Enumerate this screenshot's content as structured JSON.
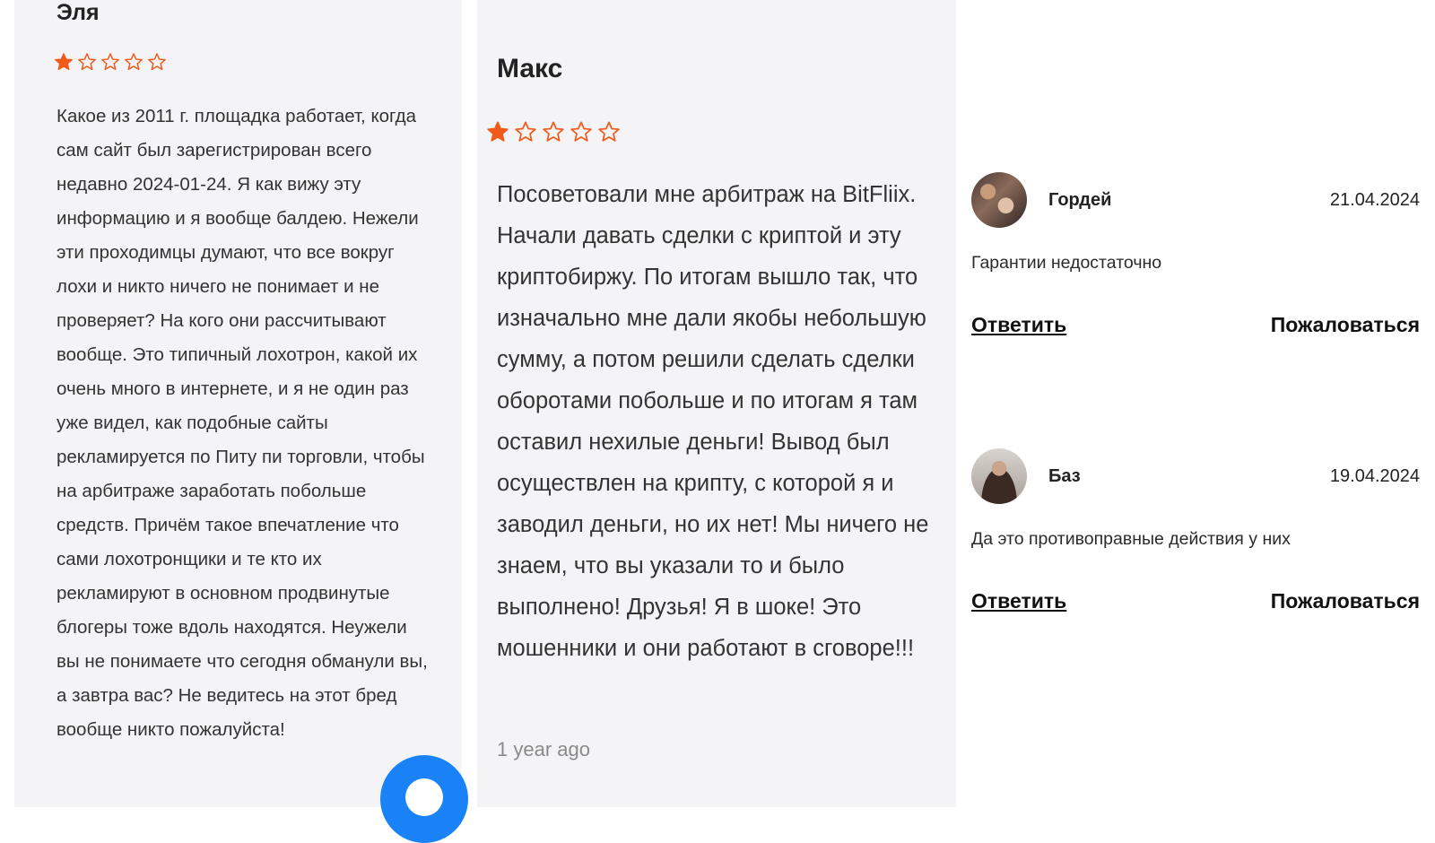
{
  "reviews": [
    {
      "author": "Эля",
      "rating": 1,
      "rating_max": 5,
      "text": "Какое из 2011 г. площадка работает, когда сам сайт был зарегистрирован всего недавно 2024-01-24. Я как вижу эту информацию и я вообще балдею. Нежели эти проходимцы думают, что все вокруг лохи и никто ничего не понимает и не проверяет? На кого они рассчитывают вообще. Это типичный лохотрон, какой их очень много в интернете, и я не один раз уже видел, как подобные сайты рекламируется по Питу пи торговли, чтобы на арбитраже заработать побольше средств. Причём такое впечатление что сами лохотронщики и те кто их рекламируют в основном продвинутые блогеры тоже вдоль находятся. Неужели вы не понимаете что сегодня обманули вы, а завтра вас? Не ведитесь на этот бред вообще никто пожалуйста!"
    },
    {
      "author": "Макс",
      "rating": 1,
      "rating_max": 5,
      "text": "Посоветовали мне арбитраж на BitFliix. Начали давать сделки с криптой и эту криптобиржу. По итогам вышло так, что изначально мне дали якобы небольшую сумму, а потом решили сделать сделки оборотами побольше и по итогам я там оставил нехилые деньги! Вывод был осуществлен на крипту, с которой я и заводил деньги, но их нет! Мы ничего не знаем, что вы указали то и было выполнено! Друзья! Я в шоке! Это мошенники и они работают в сговоре!!!",
      "time_ago": "1 year ago"
    }
  ],
  "comments": [
    {
      "name": "Гордей",
      "date": "21.04.2024",
      "text": "Гарантии недостаточно",
      "reply_label": "Ответить",
      "report_label": "Пожаловаться"
    },
    {
      "name": "Баз",
      "date": "19.04.2024",
      "text": "Да это противоправные действия у них",
      "reply_label": "Ответить",
      "report_label": "Пожаловаться"
    }
  ],
  "colors": {
    "star": "#f05a1a",
    "fab": "#1a82f7",
    "card_bg": "#f4f4f6"
  },
  "icons": {
    "fab": "chat-bubble-icon",
    "star_filled": "star-filled-icon",
    "star_empty": "star-outline-icon"
  }
}
